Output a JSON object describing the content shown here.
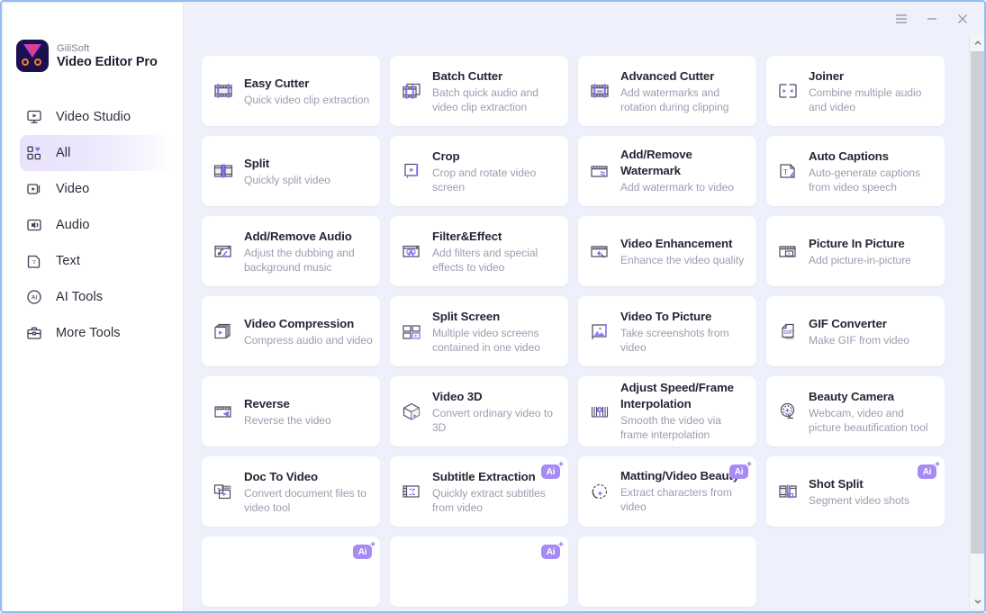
{
  "app": {
    "brand": "GiliSoft",
    "product": "Video Editor Pro"
  },
  "titlebar": {
    "menu_label": "☰",
    "minimize_label": "–",
    "close_label": "✕"
  },
  "sidebar": {
    "items": [
      {
        "label": "Video Studio",
        "icon": "video-studio-icon",
        "active": false
      },
      {
        "label": "All",
        "icon": "all-grid-icon",
        "active": true
      },
      {
        "label": "Video",
        "icon": "video-icon",
        "active": false
      },
      {
        "label": "Audio",
        "icon": "audio-icon",
        "active": false
      },
      {
        "label": "Text",
        "icon": "text-icon",
        "active": false
      },
      {
        "label": "AI Tools",
        "icon": "ai-tools-icon",
        "active": false
      },
      {
        "label": "More Tools",
        "icon": "more-tools-icon",
        "active": false
      }
    ]
  },
  "main": {
    "cards": [
      {
        "title": "Easy Cutter",
        "desc": "Quick video clip extraction",
        "icon": "film-cut-icon",
        "ai": false
      },
      {
        "title": "Batch Cutter",
        "desc": "Batch quick audio and video clip extraction",
        "icon": "film-stack-icon",
        "ai": false
      },
      {
        "title": "Advanced Cutter",
        "desc": "Add watermarks and rotation during clipping",
        "icon": "film-crown-icon",
        "ai": false
      },
      {
        "title": "Joiner",
        "desc": "Combine multiple audio and video",
        "icon": "join-arrows-icon",
        "ai": false
      },
      {
        "title": "Split",
        "desc": "Quickly split video",
        "icon": "split-panels-icon",
        "ai": false
      },
      {
        "title": "Crop",
        "desc": "Crop and rotate video screen",
        "icon": "crop-play-icon",
        "ai": false
      },
      {
        "title": "Add/Remove Watermark",
        "desc": "Add watermark to video",
        "icon": "watermark-icon",
        "ai": false
      },
      {
        "title": "Auto Captions",
        "desc": "Auto-generate captions from video speech",
        "icon": "captions-icon",
        "ai": false
      },
      {
        "title": "Add/Remove Audio",
        "desc": "Adjust the dubbing and background music",
        "icon": "audio-note-icon",
        "ai": false
      },
      {
        "title": "Filter&Effect",
        "desc": "Add filters and special effects to video",
        "icon": "filter-circles-icon",
        "ai": false
      },
      {
        "title": "Video Enhancement",
        "desc": "Enhance the video quality",
        "icon": "enhance-wand-icon",
        "ai": false
      },
      {
        "title": "Picture In Picture",
        "desc": "Add picture-in-picture",
        "icon": "pip-icon",
        "ai": false
      },
      {
        "title": "Video Compression",
        "desc": "Compress audio and video",
        "icon": "compress-stack-icon",
        "ai": false
      },
      {
        "title": "Split Screen",
        "desc": "Multiple video screens contained in one video",
        "icon": "split-screen-icon",
        "ai": false
      },
      {
        "title": "Video To Picture",
        "desc": "Take screenshots from video",
        "icon": "picture-icon",
        "ai": false
      },
      {
        "title": "GIF Converter",
        "desc": "Make GIF from video",
        "icon": "gif-icon",
        "ai": false
      },
      {
        "title": "Reverse",
        "desc": "Reverse the video",
        "icon": "reverse-icon",
        "ai": false
      },
      {
        "title": "Video 3D",
        "desc": "Convert ordinary video to 3D",
        "icon": "cube-3d-icon",
        "ai": false
      },
      {
        "title": "Adjust Speed/Frame Interpolation",
        "desc": "Smooth the video via frame interpolation",
        "icon": "speed-frame-icon",
        "ai": false
      },
      {
        "title": "Beauty Camera",
        "desc": "Webcam, video and picture beautification tool",
        "icon": "beauty-camera-icon",
        "ai": false
      },
      {
        "title": "Doc To Video",
        "desc": "Convert document files to video tool",
        "icon": "doc-video-icon",
        "ai": false
      },
      {
        "title": "Subtitle Extraction",
        "desc": "Quickly extract subtitles from video",
        "icon": "subtitle-icon",
        "ai": true
      },
      {
        "title": "Matting/Video Beauty",
        "desc": "Extract characters from video",
        "icon": "matting-icon",
        "ai": true
      },
      {
        "title": "Shot Split",
        "desc": "Segment video shots",
        "icon": "shot-split-icon",
        "ai": true
      },
      {
        "title": "",
        "desc": "",
        "icon": "partial-card-icon",
        "ai": true
      },
      {
        "title": "",
        "desc": "",
        "icon": "partial-card-icon",
        "ai": true
      },
      {
        "title": "",
        "desc": "",
        "icon": "partial-card-icon",
        "ai": false
      }
    ],
    "ai_badge_label": "Ai",
    "ai_badge_spark": "✦"
  },
  "scrollbar": {
    "up_label": "⌃",
    "down_label": "⌄"
  },
  "colors": {
    "accent": "#8c6ef0",
    "content_bg": "#eef1fb",
    "card_bg": "#ffffff",
    "window_border": "#93bdf0",
    "title_text": "#242736",
    "desc_text": "#9a9eb0"
  }
}
